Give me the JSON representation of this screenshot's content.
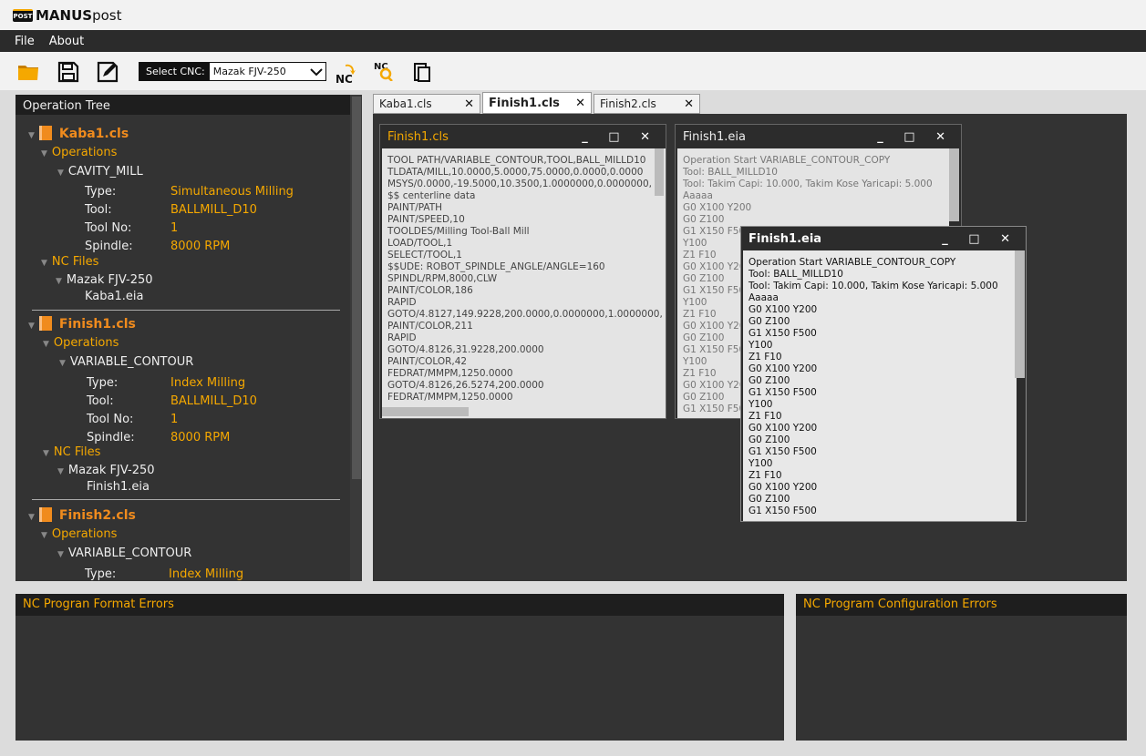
{
  "app": {
    "logo_text": "POST",
    "title_bold": "MANUS",
    "title_rest": "post"
  },
  "menu": [
    "File",
    "About"
  ],
  "toolbar": {
    "cnc_label": "Select CNC:",
    "cnc_value": "Mazak FJV-250",
    "nc_label": "NC"
  },
  "colors": {
    "accent": "#f5a800",
    "file": "#f08b1d",
    "panel": "#333333"
  },
  "tree": {
    "header": "Operation Tree",
    "files": [
      {
        "name": "Kaba1.cls",
        "ops_label": "Operations",
        "op": "CAVITY_MILL",
        "props": [
          {
            "k": "Type:",
            "v": "Simultaneous Milling"
          },
          {
            "k": "Tool:",
            "v": "BALLMILL_D10"
          },
          {
            "k": "Tool No:",
            "v": "1"
          },
          {
            "k": "Spindle:",
            "v": "8000 RPM"
          }
        ],
        "nc_label": "NC Files",
        "machine": "Mazak FJV-250",
        "nc_file": "Kaba1.eia"
      },
      {
        "name": "Finish1.cls",
        "ops_label": "Operations",
        "op": "VARIABLE_CONTOUR",
        "props": [
          {
            "k": "Type:",
            "v": "Index Milling"
          },
          {
            "k": "Tool:",
            "v": "BALLMILL_D10"
          },
          {
            "k": "Tool No:",
            "v": "1"
          },
          {
            "k": "Spindle:",
            "v": "8000 RPM"
          }
        ],
        "nc_label": "NC Files",
        "machine": "Mazak FJV-250",
        "nc_file": "Finish1.eia"
      },
      {
        "name": "Finish2.cls",
        "ops_label": "Operations",
        "op": "VARIABLE_CONTOUR",
        "props": [
          {
            "k": "Type:",
            "v": "Index Milling"
          }
        ]
      }
    ]
  },
  "tabs": [
    {
      "label": "Kaba1.cls",
      "active": false
    },
    {
      "label": "Finish1.cls",
      "active": true
    },
    {
      "label": "Finish2.cls",
      "active": false
    }
  ],
  "windows": {
    "cls": {
      "title": "Finish1.cls",
      "text": "TOOL PATH/VARIABLE_CONTOUR,TOOL,BALL_MILLD10\nTLDATA/MILL,10.0000,5.0000,75.0000,0.0000,0.0000\nMSYS/0.0000,-19.5000,10.3500,1.0000000,0.0000000,\n$$ centerline data\nPAINT/PATH\nPAINT/SPEED,10\nTOOLDES/Milling Tool-Ball Mill\nLOAD/TOOL,1\nSELECT/TOOL,1\n$$UDE: ROBOT_SPINDLE_ANGLE/ANGLE=160\nSPINDL/RPM,8000,CLW\nPAINT/COLOR,186\nRAPID\nGOTO/4.8127,149.9228,200.0000,0.0000000,1.0000000,\nPAINT/COLOR,211\nRAPID\nGOTO/4.8126,31.9228,200.0000\nPAINT/COLOR,42\nFEDRAT/MMPM,1250.0000\nGOTO/4.8126,26.5274,200.0000\nFEDRAT/MMPM,1250.0000"
    },
    "eia_back": {
      "title": "Finish1.eia",
      "text": "Operation Start VARIABLE_CONTOUR_COPY\nTool: BALL_MILLD10\nTool: Takim Capi: 10.000, Takim Kose Yaricapi: 5.000\nAaaaa\nG0 X100 Y200\nG0 Z100\nG1 X150 F500\nY100\nZ1 F10\nG0 X100 Y200\nG0 Z100\nG1 X150 F500\nY100\nZ1 F10\nG0 X100 Y200\nG0 Z100\nG1 X150 F500\nY100\nZ1 F10\nG0 X100 Y200\nG0 Z100\nG1 X150 F500"
    },
    "eia_front": {
      "title": "Finish1.eia",
      "text": "Operation Start VARIABLE_CONTOUR_COPY\nTool: BALL_MILLD10\nTool: Takim Capi: 10.000, Takim Kose Yaricapi: 5.000\nAaaaa\nG0 X100 Y200\nG0 Z100\nG1 X150 F500\nY100\nZ1 F10\nG0 X100 Y200\nG0 Z100\nG1 X150 F500\nY100\nZ1 F10\nG0 X100 Y200\nG0 Z100\nG1 X150 F500\nY100\nZ1 F10\nG0 X100 Y200\nG0 Z100\nG1 X150 F500"
    }
  },
  "errors": {
    "format_title": "NC Progran Format Errors",
    "config_title": "NC Program Configuration Errors"
  }
}
